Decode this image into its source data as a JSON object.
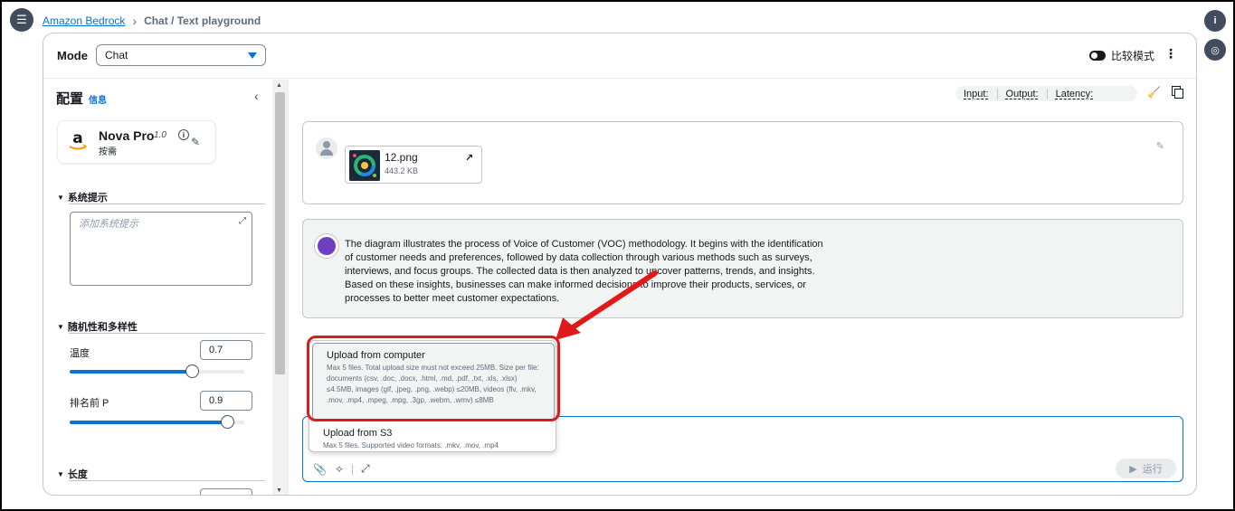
{
  "breadcrumb": {
    "root": "Amazon Bedrock",
    "current": "Chat / Text playground"
  },
  "mode": {
    "label": "Mode",
    "value": "Chat"
  },
  "compare": {
    "label": "比较模式"
  },
  "config": {
    "title": "配置",
    "info": "信息",
    "model": {
      "name": "Nova Pro",
      "version": "1.0",
      "sub": "按需"
    },
    "system_prompt": {
      "heading": "系统提示",
      "placeholder": "添加系统提示"
    },
    "randomness": {
      "heading": "随机性和多样性",
      "temperature": {
        "label": "温度",
        "value": "0.7",
        "fraction": 0.7
      },
      "top_p": {
        "label": "排名前 P",
        "value": "0.9",
        "fraction": 0.9
      }
    },
    "length": {
      "heading": "长度"
    }
  },
  "metrics": {
    "input": "Input: ",
    "output": "Output: ",
    "latency": "Latency: "
  },
  "user_message": {
    "file_name": "12.png",
    "file_size": "443.2 KB"
  },
  "ai_message": {
    "text": "The diagram illustrates the process of Voice of Customer (VOC) methodology. It begins with the identification of customer needs and preferences, followed by data collection through various methods such as surveys, interviews, and focus groups. The collected data is then analyzed to uncover patterns, trends, and insights. Based on these insights, businesses can make informed decisions to improve their products, services, or processes to better meet customer expectations."
  },
  "upload_menu": {
    "computer": {
      "title": "Upload from computer",
      "desc": "Max 5 files. Total upload size must not exceed 25MB. Size per file: documents (csv, .doc, .docx, .html, .md, .pdf, .txt, .xls, .xlsx) ≤4.5MB, images (gif, .jpeg, .png, .webp) ≤20MB, videos (flv, .mkv, .mov, .mp4, .mpeg, .mpg, .3gp, .webm, .wmv) ≤8MB"
    },
    "s3": {
      "title": "Upload from S3",
      "desc": "Max 5 files. Supported video formats: .mkv, .mov, .mp4"
    }
  },
  "composer": {
    "run_label": "运行"
  },
  "colors": {
    "accent": "#0972d3",
    "highlight": "#e01a1a",
    "dark": "#414d5c"
  }
}
